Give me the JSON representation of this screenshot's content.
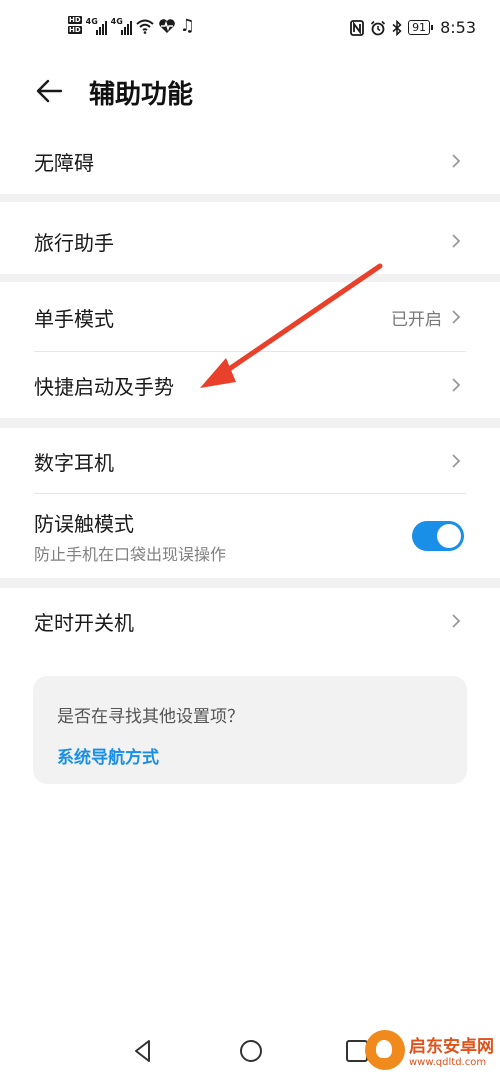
{
  "status_bar": {
    "hd1": "HD",
    "hd2": "HD",
    "net1": "4G",
    "net2": "4G",
    "battery": "91",
    "time": "8:53"
  },
  "header": {
    "title": "辅助功能"
  },
  "items": {
    "accessibility": "无障碍",
    "travel_assistant": "旅行助手",
    "one_hand_mode": "单手模式",
    "one_hand_mode_status": "已开启",
    "shortcuts_gestures": "快捷启动及手势",
    "digital_headset": "数字耳机",
    "pocket_mode": "防误触模式",
    "pocket_mode_desc": "防止手机在口袋出现误操作",
    "scheduled_power": "定时开关机"
  },
  "toggles": {
    "pocket_mode_on": true,
    "accent_color": "#1a8fe8"
  },
  "suggestion": {
    "question": "是否在寻找其他设置项？",
    "link": "系统导航方式"
  },
  "annotation": {
    "arrow_color": "#e8402a"
  },
  "watermark": {
    "name": "启东安卓网",
    "url": "www.qdltd.com"
  }
}
